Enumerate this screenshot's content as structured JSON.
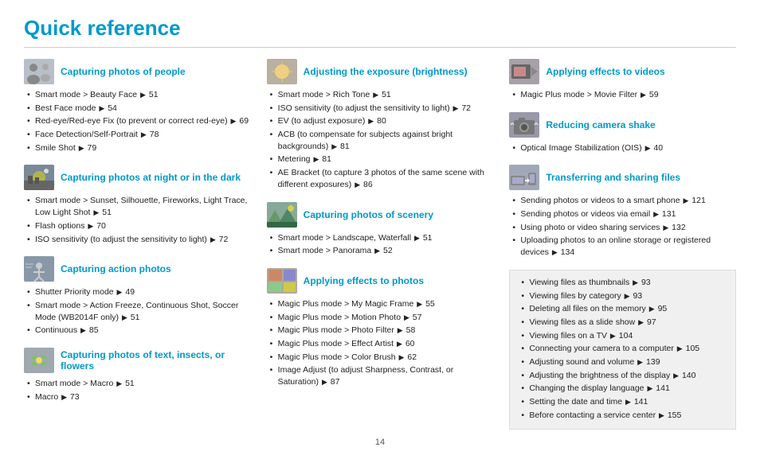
{
  "title": "Quick reference",
  "page_number": "14",
  "columns": [
    {
      "id": "col1",
      "sections": [
        {
          "id": "capturing-people",
          "icon": "people",
          "title": "Capturing photos of people",
          "items": [
            "Smart mode > Beauty Face ▶ 51",
            "Best Face mode ▶ 54",
            "Red-eye/Red-eye Fix (to prevent or correct red-eye) ▶ 69",
            "Face Detection/Self-Portrait ▶ 78",
            "Smile Shot ▶ 79"
          ]
        },
        {
          "id": "capturing-night",
          "icon": "night",
          "title": "Capturing photos at night or in the dark",
          "items": [
            "Smart mode > Sunset, Silhouette, Fireworks, Light Trace, Low Light Shot ▶ 51",
            "Flash options ▶ 70",
            "ISO sensitivity (to adjust the sensitivity to light) ▶ 72"
          ]
        },
        {
          "id": "capturing-action",
          "icon": "action",
          "title": "Capturing action photos",
          "items": [
            "Shutter Priority mode ▶ 49",
            "Smart mode > Action Freeze, Continuous Shot, Soccer Mode (WB2014F only) ▶ 51",
            "Continuous ▶ 85"
          ]
        },
        {
          "id": "capturing-text",
          "icon": "text",
          "title": "Capturing photos of text, insects, or flowers",
          "items": [
            "Smart mode > Macro ▶ 51",
            "Macro ▶ 73"
          ]
        }
      ]
    },
    {
      "id": "col2",
      "sections": [
        {
          "id": "adjusting-exposure",
          "icon": "exposure",
          "title": "Adjusting the exposure (brightness)",
          "items": [
            "Smart mode > Rich Tone ▶ 51",
            "ISO sensitivity (to adjust the sensitivity to light) ▶ 72",
            "EV (to adjust exposure) ▶ 80",
            "ACB (to compensate for subjects against bright backgrounds) ▶ 81",
            "Metering ▶ 81",
            "AE Bracket (to capture 3 photos of the same scene with different exposures) ▶ 86"
          ]
        },
        {
          "id": "capturing-scenery",
          "icon": "scenery",
          "title": "Capturing photos of scenery",
          "items": [
            "Smart mode > Landscape, Waterfall ▶ 51",
            "Smart mode > Panorama ▶ 52"
          ]
        },
        {
          "id": "applying-effects",
          "icon": "effects",
          "title": "Applying effects to photos",
          "items": [
            "Magic Plus mode > My Magic Frame ▶ 55",
            "Magic Plus mode > Motion Photo ▶ 57",
            "Magic Plus mode > Photo Filter ▶ 58",
            "Magic Plus mode > Effect Artist ▶ 60",
            "Magic Plus mode > Color Brush ▶ 62",
            "Image Adjust (to adjust Sharpness, Contrast, or Saturation) ▶ 87"
          ]
        }
      ]
    },
    {
      "id": "col3",
      "sections": [
        {
          "id": "applying-video-effects",
          "icon": "video-effects",
          "title": "Applying effects to videos",
          "items": [
            "Magic Plus mode > Movie Filter ▶ 59"
          ]
        },
        {
          "id": "reducing-shake",
          "icon": "shake",
          "title": "Reducing camera shake",
          "items": [
            "Optical Image Stabilization (OIS) ▶ 40"
          ]
        },
        {
          "id": "transferring-files",
          "icon": "transfer",
          "title": "Transferring and sharing files",
          "items": [
            "Sending photos or videos to a smart phone ▶ 121",
            "Sending photos or videos via email ▶ 131",
            "Using photo or video sharing services ▶ 132",
            "Uploading photos to an online storage or registered devices ▶ 134"
          ]
        }
      ]
    }
  ],
  "gray_box_items": [
    "Viewing files as thumbnails ▶ 93",
    "Viewing files by category ▶ 93",
    "Deleting all files on the memory ▶ 95",
    "Viewing files as a slide show ▶ 97",
    "Viewing files on a TV ▶ 104",
    "Connecting your camera to a computer ▶ 105",
    "Adjusting sound and volume ▶ 139",
    "Adjusting the brightness of the display ▶ 140",
    "Changing the display language ▶ 141",
    "Setting the date and time ▶ 141",
    "Before contacting a service center ▶ 155"
  ]
}
